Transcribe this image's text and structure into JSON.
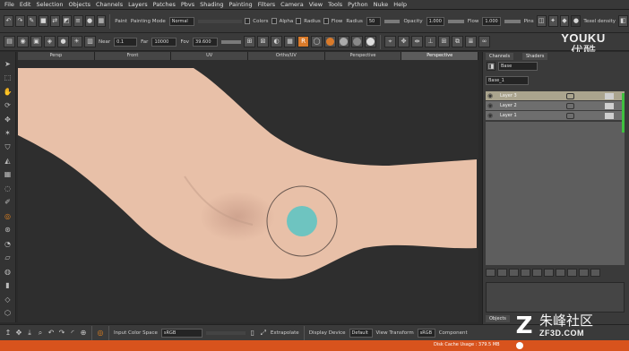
{
  "menubar": [
    "File",
    "Edit",
    "Selection",
    "Objects",
    "Channels",
    "Layers",
    "Patches",
    "Pbvs",
    "Shading",
    "Painting",
    "Filters",
    "Camera",
    "View",
    "Tools",
    "Python",
    "Nuke",
    "Help"
  ],
  "toolbar1": {
    "paint_label": "Paint",
    "painting_mode_label": "Painting Mode",
    "painting_mode_value": "Normal",
    "color_label": "Colors",
    "alpha_label": "Alpha",
    "radius_label": "Radius",
    "flow_label": "Flow",
    "radius_value": "50",
    "opacity_label": "Opacity",
    "opacity_value": "1.000",
    "flow_value": "1.000",
    "pins_label": "Pins",
    "texel_density_label": "Texel density"
  },
  "toolbar2": {
    "near_label": "Near",
    "near_value": "0.1",
    "far_label": "Far",
    "far_value": "10000",
    "fov_label": "Fov",
    "fov_value": "39.600"
  },
  "logo": {
    "line1": "YOUKU",
    "line2": "优酷"
  },
  "tabs": [
    "Persp",
    "Front",
    "UV",
    "Ortho/UV",
    "Perspective",
    "Perspective"
  ],
  "active_tab_index": 5,
  "right_panel": {
    "tab_layers": "Channels",
    "tab_shaders": "Shaders",
    "dropdown1": "Base",
    "dropdown2": "Base_1",
    "layers": [
      {
        "name": "Layer 3",
        "selected": true
      },
      {
        "name": "Layer 2",
        "selected": false
      },
      {
        "name": "Layer 1",
        "selected": false
      }
    ],
    "objects_tab": "Objects"
  },
  "bottombar": {
    "input_color_space_label": "Input Color Space",
    "input_color_space_value": "sRGB",
    "extrapolate_label": "Extrapolate",
    "display_device_label": "Display Device",
    "display_device_value": "Default",
    "view_transform_label": "View Transform",
    "view_transform_value": "sRGB",
    "component_label": "Component"
  },
  "status_text": "Disk Cache Usage : 379.5 MB",
  "watermark": {
    "chinese": "朱峰社区",
    "site": "ZF3D.COM"
  },
  "colors": {
    "skin": "#e8c0a8",
    "brush_fill": "#6ec4c0",
    "status_orange": "#d8531d",
    "accent_orange": "#d97a2a",
    "selected_layer": "#aaa48e",
    "green_indicator": "#3fc03f"
  },
  "icons": {
    "left_tools": [
      "cursor-icon",
      "select-icon",
      "hand-icon",
      "rotate-icon",
      "move-icon",
      "magic-wand-icon",
      "paint-bucket-icon",
      "slice-icon",
      "grid-icon",
      "lasso-icon",
      "picker-icon",
      "paint-brush-icon",
      "clone-icon",
      "smudge-icon",
      "eraser-icon",
      "blur-icon",
      "gradient-icon",
      "flatten-icon",
      "transform-icon",
      "mask-icon"
    ]
  }
}
